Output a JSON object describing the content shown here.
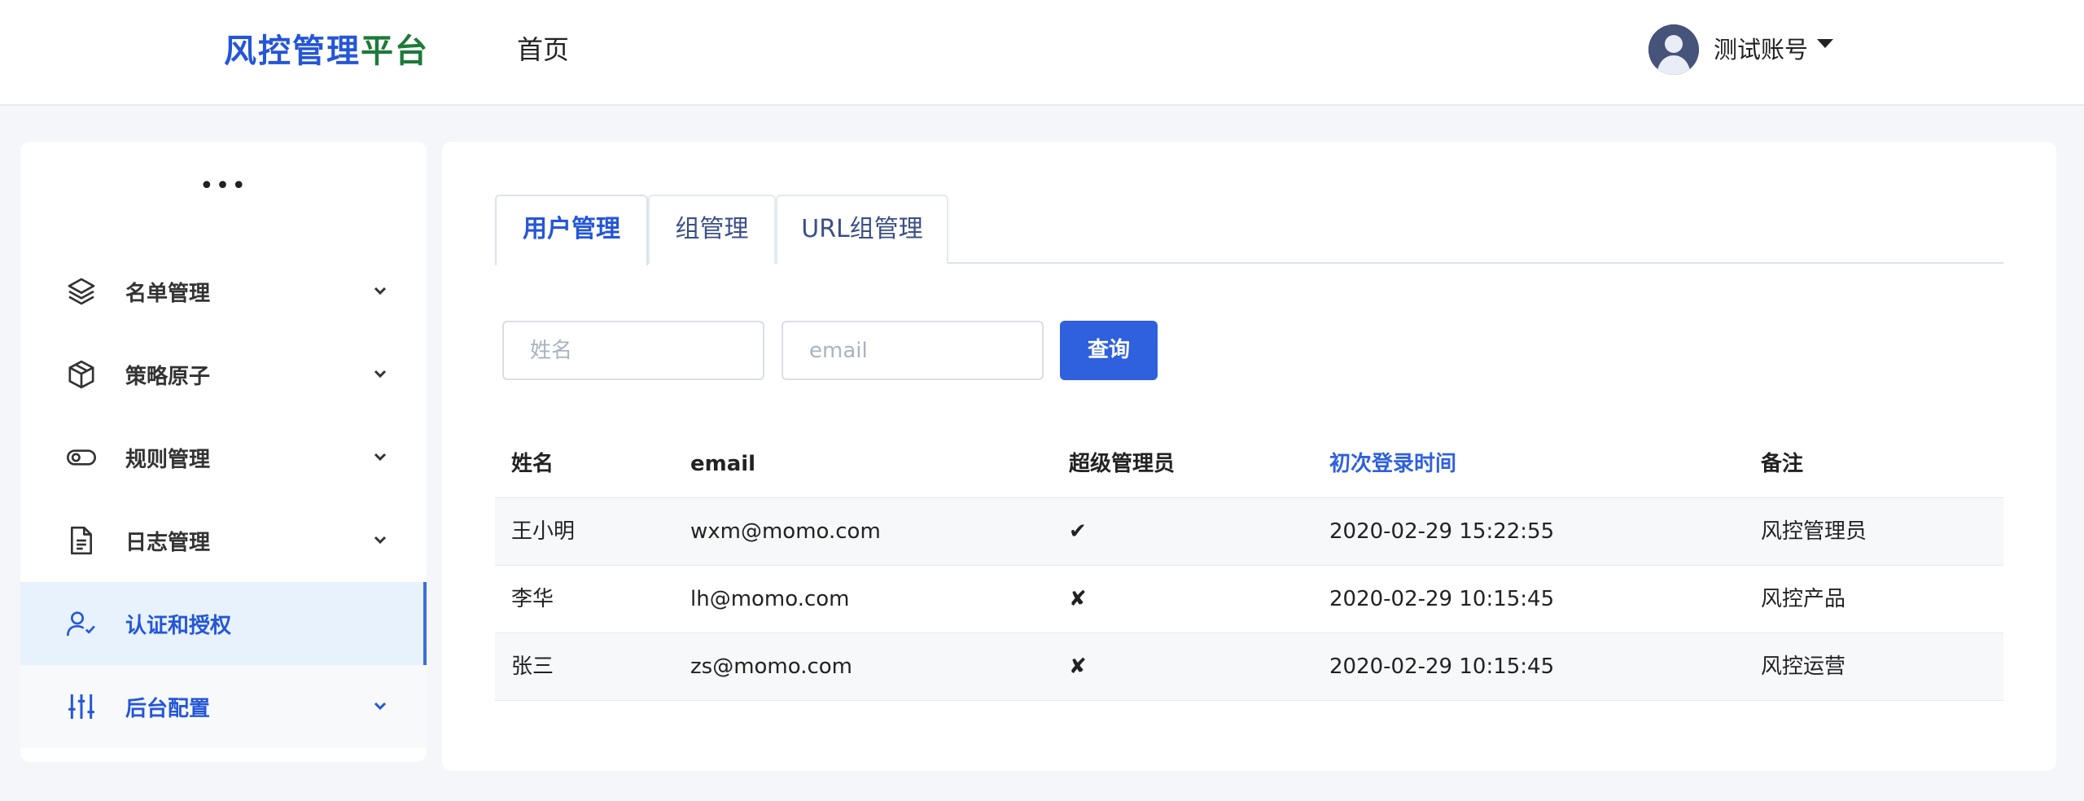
{
  "brand": {
    "part1": "风控管理",
    "part2": "平台"
  },
  "nav": {
    "home": "首页"
  },
  "user": {
    "name": "测试账号"
  },
  "sidebar": {
    "more": "•••",
    "items": [
      {
        "label": "名单管理",
        "icon": "layers-icon"
      },
      {
        "label": "策略原子",
        "icon": "cube-icon"
      },
      {
        "label": "规则管理",
        "icon": "toggle-icon"
      },
      {
        "label": "日志管理",
        "icon": "document-icon"
      },
      {
        "label": "认证和授权",
        "icon": "user-check-icon",
        "active": true
      },
      {
        "label": "后台配置",
        "icon": "sliders-icon"
      }
    ]
  },
  "tabs": [
    {
      "label": "用户管理",
      "active": true
    },
    {
      "label": "组管理"
    },
    {
      "label": "URL组管理"
    }
  ],
  "search": {
    "name_placeholder": "姓名",
    "email_placeholder": "email",
    "query_label": "查询"
  },
  "table": {
    "headers": [
      "姓名",
      "email",
      "超级管理员",
      "初次登录时间",
      "备注"
    ],
    "rows": [
      [
        "王小明",
        "wxm@momo.com",
        "✔",
        "2020-02-29 15:22:55",
        "风控管理员"
      ],
      [
        "李华",
        "lh@momo.com",
        "✘",
        "2020-02-29 10:15:45",
        "风控产品"
      ],
      [
        "张三",
        "zs@momo.com",
        "✘",
        "2020-02-29 10:15:45",
        "风控运营"
      ]
    ]
  },
  "colors": {
    "accent": "#2f60dd",
    "brand_green": "#1e7a3a",
    "active_bg": "#e8f2fc"
  }
}
